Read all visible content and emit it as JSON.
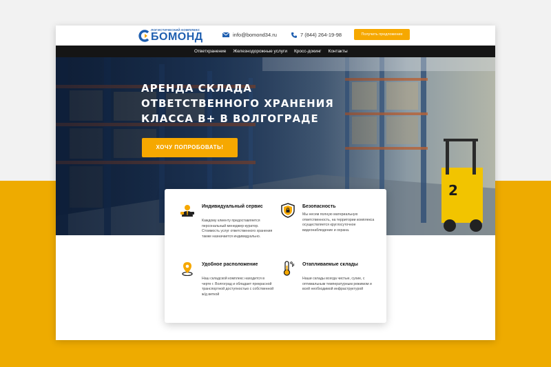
{
  "header": {
    "logo_subtitle": "ЛОГИСТИЧЕСКИЙ КОМПЛЕКС",
    "logo_name": "БОМОНД",
    "email": "info@bomond34.ru",
    "phone": "7 (844) 264-19-98",
    "cta_label": "Получить предложение"
  },
  "nav": {
    "items": [
      {
        "label": "Ответхранение"
      },
      {
        "label": "Железнодорожные услуги"
      },
      {
        "label": "Кросс-докинг"
      },
      {
        "label": "Контакты"
      }
    ]
  },
  "hero": {
    "title_lines": [
      "АРЕНДА СКЛАДА",
      "ОТВЕТСТВЕННОГО ХРАНЕНИЯ",
      "КЛАССА В+ В ВОЛГОГРАДЕ"
    ],
    "button_label": "ХОЧУ ПОПРОБОВАТЬ!",
    "forklift_number": "2"
  },
  "features": [
    {
      "icon": "manager-icon",
      "title": "Индивидуальный сервис",
      "text": "Каждому клиенту предоставляется персональный менеджер-куратор. Стоимость услуг ответственного хранения также назначается индивидуально."
    },
    {
      "icon": "shield-icon",
      "title": "Безопасность",
      "text": "Мы несем полную материальную ответственность, на территории комплекса осуществляется круглосуточное видеонаблюдение и охрана."
    },
    {
      "icon": "location-pin-icon",
      "title": "Удобное расположение",
      "text": "Наш складской комплекс находится в черте г. Волгоград и обладает прекрасной транспортной доступностью с собственной ж/д веткой"
    },
    {
      "icon": "thermometer-icon",
      "title": "Отапливаемые склады",
      "text": "Наши склады всегда чистые, сухие, с оптимальным температурным режимом и всей необходимой инфраструктурой"
    }
  ],
  "colors": {
    "accent": "#f6a800",
    "brand_blue": "#1f5fb0",
    "nav_bg": "#151515",
    "page_band": "#eeab00"
  }
}
